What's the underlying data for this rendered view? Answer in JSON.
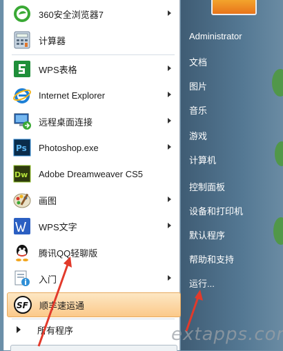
{
  "programs": [
    {
      "label": "360安全浏览器7",
      "icon": "browser-360-icon",
      "submenu": true
    },
    {
      "label": "计算器",
      "icon": "calculator-icon",
      "submenu": false
    },
    {
      "label": "WPS表格",
      "icon": "wps-spreadsheet-icon",
      "submenu": true
    },
    {
      "label": "Internet Explorer",
      "icon": "internet-explorer-icon",
      "submenu": true
    },
    {
      "label": "远程桌面连接",
      "icon": "remote-desktop-icon",
      "submenu": true
    },
    {
      "label": "Photoshop.exe",
      "icon": "photoshop-icon",
      "submenu": true
    },
    {
      "label": "Adobe Dreamweaver CS5",
      "icon": "dreamweaver-icon",
      "submenu": false
    },
    {
      "label": "画图",
      "icon": "paint-icon",
      "submenu": true
    },
    {
      "label": "WPS文字",
      "icon": "wps-writer-icon",
      "submenu": true
    },
    {
      "label": "腾讯QQ轻聊版",
      "icon": "qq-icon",
      "submenu": false
    },
    {
      "label": "入门",
      "icon": "getting-started-icon",
      "submenu": true
    },
    {
      "label": "顺丰速运通",
      "icon": "sf-express-icon",
      "submenu": false
    }
  ],
  "all_programs_label": "所有程序",
  "right": {
    "user": "Administrator",
    "documents": "文档",
    "pictures": "图片",
    "music": "音乐",
    "games": "游戏",
    "computer": "计算机",
    "control_panel": "控制面板",
    "devices_printers": "设备和打印机",
    "default_programs": "默认程序",
    "help_support": "帮助和支持",
    "run": "运行..."
  },
  "watermark": "extapps.com",
  "colors": {
    "selected_bg": "#fbc98a",
    "right_pane": "#4a6a85",
    "arrow": "#e23a2b"
  }
}
